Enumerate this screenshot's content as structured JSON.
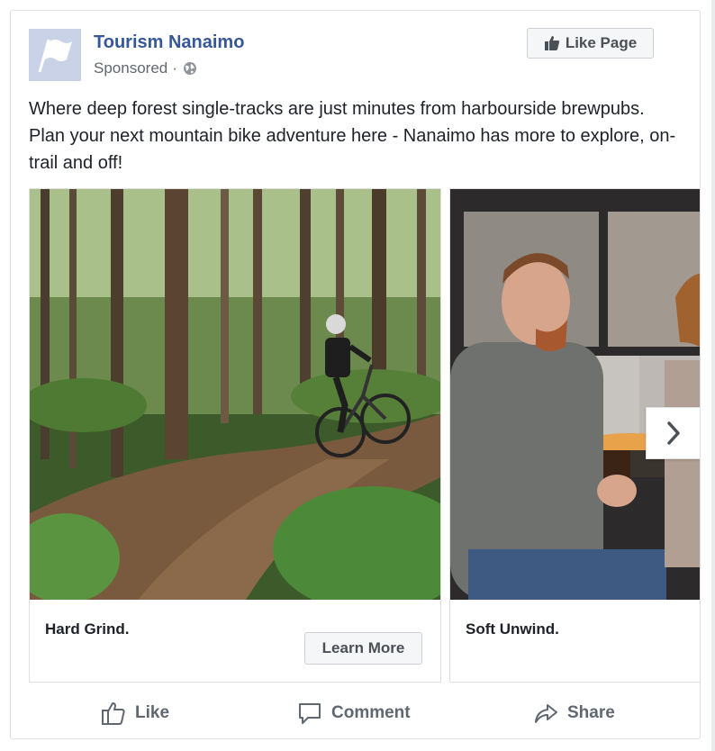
{
  "post": {
    "page_name": "Tourism Nanaimo",
    "sponsored": "Sponsored",
    "separator": "·",
    "like_page": "Like Page",
    "text": "Where deep forest single-tracks are just minutes from harbourside brewpubs. Plan your next mountain bike adventure here - Nanaimo has more to explore, on-trail and off!"
  },
  "carousel": {
    "cards": [
      {
        "title": "Hard Grind.",
        "cta": "Learn More",
        "image": "forest-mountain-biker-photo"
      },
      {
        "title": "Soft Unwind.",
        "image": "brewpub-people-photo"
      }
    ],
    "next_icon": "chevron-right-icon"
  },
  "actions": {
    "like": "Like",
    "comment": "Comment",
    "share": "Share"
  },
  "colors": {
    "link": "#365899",
    "text": "#1d2129",
    "muted": "#606770",
    "border": "#dddfe2"
  }
}
